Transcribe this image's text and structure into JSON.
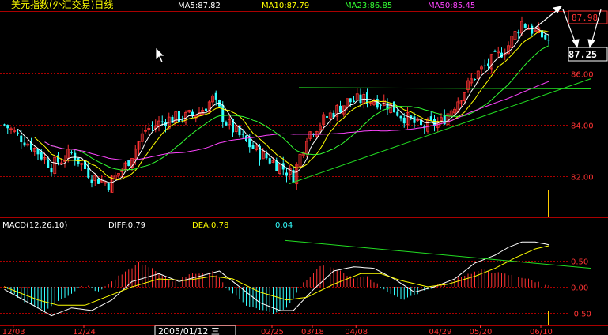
{
  "header": {
    "title": "美元指数(外汇交易)日线",
    "ma5": "MA5:87.82",
    "ma10": "MA10:87.79",
    "ma23": "MA23:86.85",
    "ma50": "MA50:85.45"
  },
  "macd_header": {
    "label": "MACD(12,26,10)",
    "diff": "DIFF:0.79",
    "dea": "DEA:0.78",
    "macd": "0.04"
  },
  "price_axis": {
    "current_top": "87.98",
    "current_price": "87.25",
    "ticks": [
      {
        "value": 86.0,
        "label": "86.00"
      },
      {
        "value": 84.0,
        "label": "84.00"
      },
      {
        "value": 82.0,
        "label": "82.00"
      }
    ]
  },
  "macd_axis": {
    "ticks": [
      {
        "value": 0.5,
        "label": "0.50"
      },
      {
        "value": 0.0,
        "label": "0.00"
      },
      {
        "value": -0.5,
        "label": "-0.50"
      }
    ]
  },
  "x_axis": {
    "labels": [
      "12/03",
      "12/24",
      "02/25",
      "03/18",
      "04/08",
      "04/29",
      "05/20",
      "06/10"
    ],
    "cursor_date": "2005/01/12 三"
  },
  "colors": {
    "up": "#ff3333",
    "down": "#33ffff",
    "ma5": "#ffffff",
    "ma10": "#ffff00",
    "ma23": "#33ff33",
    "ma50": "#ff44ff",
    "grid": "#aa0000",
    "trend": "#22dd22"
  },
  "chart_data": {
    "type": "candlestick",
    "title": "美元指数(外汇交易)日线",
    "y_range": [
      80.4,
      88.4
    ],
    "macd_range": [
      -0.72,
      1.05
    ],
    "price_keypoints": [
      [
        0,
        84.0
      ],
      [
        8,
        83.2
      ],
      [
        14,
        82.4
      ],
      [
        20,
        82.9
      ],
      [
        26,
        82.0
      ],
      [
        31,
        81.7
      ],
      [
        36,
        82.4
      ],
      [
        42,
        83.8
      ],
      [
        48,
        84.2
      ],
      [
        54,
        84.3
      ],
      [
        58,
        84.5
      ],
      [
        62,
        85.0
      ],
      [
        66,
        84.1
      ],
      [
        72,
        83.3
      ],
      [
        77,
        82.8
      ],
      [
        82,
        82.4
      ],
      [
        86,
        82.0
      ],
      [
        90,
        83.6
      ],
      [
        96,
        84.3
      ],
      [
        102,
        84.9
      ],
      [
        108,
        85.0
      ],
      [
        113,
        84.9
      ],
      [
        118,
        84.4
      ],
      [
        124,
        83.9
      ],
      [
        130,
        84.1
      ],
      [
        134,
        84.8
      ],
      [
        140,
        85.9
      ],
      [
        146,
        86.6
      ],
      [
        150,
        87.1
      ],
      [
        154,
        88.0
      ],
      [
        158,
        87.6
      ],
      [
        162,
        87.3
      ]
    ],
    "macd_hist_keypoints": [
      [
        0,
        0
      ],
      [
        6,
        -0.3
      ],
      [
        12,
        -0.45
      ],
      [
        18,
        -0.2
      ],
      [
        24,
        0.05
      ],
      [
        28,
        -0.1
      ],
      [
        34,
        0.2
      ],
      [
        40,
        0.45
      ],
      [
        44,
        0.35
      ],
      [
        50,
        0.1
      ],
      [
        56,
        0.25
      ],
      [
        62,
        0.3
      ],
      [
        66,
        0.0
      ],
      [
        72,
        -0.35
      ],
      [
        80,
        -0.5
      ],
      [
        84,
        -0.4
      ],
      [
        88,
        0.0
      ],
      [
        94,
        0.4
      ],
      [
        100,
        0.3
      ],
      [
        104,
        0.15
      ],
      [
        108,
        0.2
      ],
      [
        112,
        0.0
      ],
      [
        118,
        -0.25
      ],
      [
        124,
        -0.1
      ],
      [
        130,
        0.05
      ],
      [
        136,
        0.2
      ],
      [
        142,
        0.32
      ],
      [
        148,
        0.25
      ],
      [
        154,
        0.18
      ],
      [
        158,
        0.1
      ],
      [
        162,
        0.04
      ]
    ],
    "diff_keypoints": [
      [
        0,
        -0.05
      ],
      [
        10,
        -0.4
      ],
      [
        14,
        -0.55
      ],
      [
        20,
        -0.4
      ],
      [
        26,
        -0.45
      ],
      [
        32,
        -0.25
      ],
      [
        38,
        0.1
      ],
      [
        46,
        0.25
      ],
      [
        52,
        0.1
      ],
      [
        58,
        0.2
      ],
      [
        64,
        0.3
      ],
      [
        70,
        0.0
      ],
      [
        76,
        -0.3
      ],
      [
        82,
        -0.45
      ],
      [
        86,
        -0.45
      ],
      [
        92,
        -0.05
      ],
      [
        98,
        0.3
      ],
      [
        104,
        0.38
      ],
      [
        110,
        0.35
      ],
      [
        116,
        0.15
      ],
      [
        122,
        -0.1
      ],
      [
        128,
        0.0
      ],
      [
        134,
        0.15
      ],
      [
        140,
        0.45
      ],
      [
        146,
        0.6
      ],
      [
        150,
        0.75
      ],
      [
        154,
        0.85
      ],
      [
        158,
        0.85
      ],
      [
        162,
        0.8
      ]
    ],
    "dea_keypoints": [
      [
        0,
        0.0
      ],
      [
        10,
        -0.25
      ],
      [
        16,
        -0.35
      ],
      [
        24,
        -0.35
      ],
      [
        30,
        -0.2
      ],
      [
        38,
        0.0
      ],
      [
        46,
        0.15
      ],
      [
        54,
        0.12
      ],
      [
        62,
        0.2
      ],
      [
        68,
        0.15
      ],
      [
        76,
        -0.1
      ],
      [
        84,
        -0.25
      ],
      [
        90,
        -0.2
      ],
      [
        98,
        0.05
      ],
      [
        106,
        0.25
      ],
      [
        112,
        0.25
      ],
      [
        118,
        0.12
      ],
      [
        126,
        0.0
      ],
      [
        132,
        0.05
      ],
      [
        140,
        0.2
      ],
      [
        146,
        0.35
      ],
      [
        152,
        0.55
      ],
      [
        158,
        0.72
      ],
      [
        162,
        0.78
      ]
    ],
    "trendlines": [
      {
        "pane": "price",
        "from": [
          85,
          81.7
        ],
        "to": [
          175,
          85.8
        ]
      },
      {
        "pane": "price",
        "from": [
          88,
          85.45
        ],
        "to": [
          175,
          85.4
        ]
      },
      {
        "pane": "macd",
        "from": [
          84,
          0.88
        ],
        "to": [
          175,
          0.35
        ]
      }
    ]
  }
}
